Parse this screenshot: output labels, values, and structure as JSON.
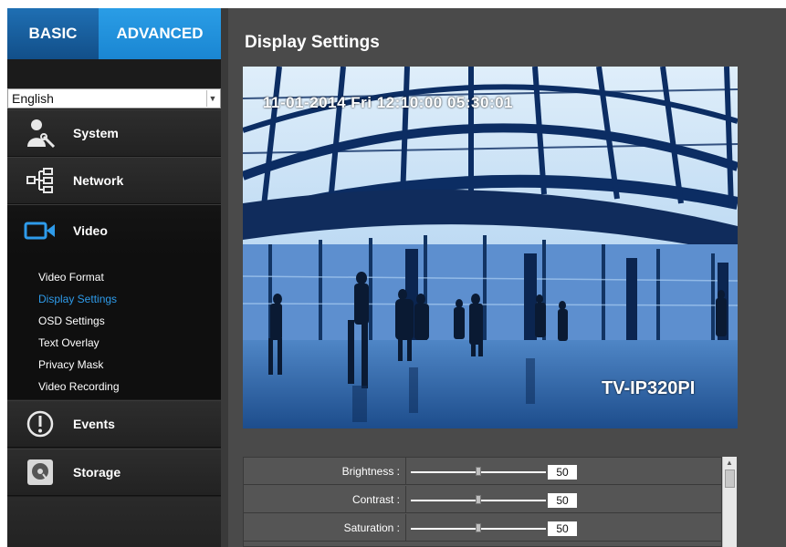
{
  "tabs": {
    "basic": "BASIC",
    "advanced": "ADVANCED"
  },
  "language": {
    "selected": "English"
  },
  "nav": {
    "system": "System",
    "network": "Network",
    "video": "Video",
    "events": "Events",
    "storage": "Storage"
  },
  "video_submenu": [
    "Video Format",
    "Display Settings",
    "OSD Settings",
    "Text Overlay",
    "Privacy Mask",
    "Video Recording"
  ],
  "page": {
    "title": "Display Settings"
  },
  "preview": {
    "timestamp": "11-01-2014 Fri 12:10:00 05:30:01",
    "model": "TV-IP320PI"
  },
  "settings": [
    {
      "label": "Brightness :",
      "value": "50",
      "level": 0.5
    },
    {
      "label": "Contrast :",
      "value": "50",
      "level": 0.5
    },
    {
      "label": "Saturation :",
      "value": "50",
      "level": 0.5
    }
  ],
  "colors": {
    "accent_blue": "#2a9de6",
    "sidebar_bg": "#1e1e1e",
    "main_bg": "#4a4a4a",
    "active_link": "#2e9bea"
  }
}
